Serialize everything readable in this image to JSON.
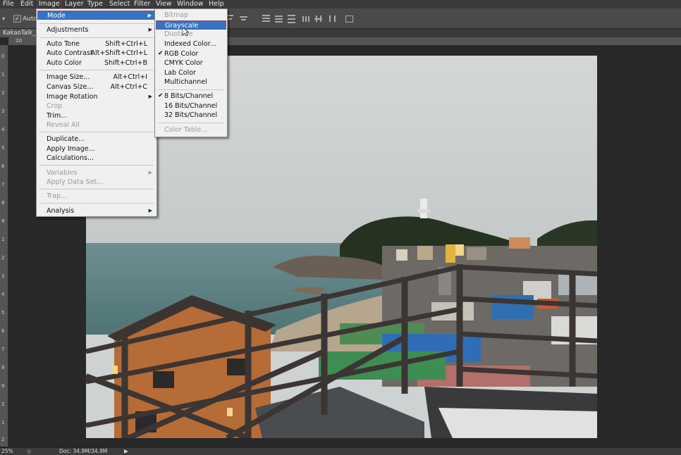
{
  "menubar": {
    "items": [
      "File",
      "Edit",
      "Image",
      "Layer",
      "Type",
      "Select",
      "Filter",
      "View",
      "Window",
      "Help"
    ]
  },
  "options": {
    "auto_label": "Auto"
  },
  "document": {
    "tab_title": "KakaoTalk_2"
  },
  "rulers": {
    "h_labels": [
      "20"
    ],
    "v_labels": [
      "0",
      "1",
      "2",
      "3",
      "4",
      "5",
      "6",
      "7",
      "8",
      "9",
      "1",
      "2",
      "3",
      "4",
      "5",
      "6",
      "7",
      "8",
      "9",
      "2",
      "1",
      "2"
    ]
  },
  "status": {
    "zoom": "25%",
    "doc": "Doc: 34.9M/34.9M"
  },
  "image_menu": {
    "items": [
      {
        "label": "Mode",
        "submenu": true,
        "highlighted": true
      },
      {
        "label": "Adjustments",
        "submenu": true
      },
      {
        "label": "Auto Tone",
        "shortcut": "Shift+Ctrl+L"
      },
      {
        "label": "Auto Contrast",
        "shortcut": "Alt+Shift+Ctrl+L"
      },
      {
        "label": "Auto Color",
        "shortcut": "Shift+Ctrl+B"
      },
      {
        "label": "Image Size...",
        "shortcut": "Alt+Ctrl+I"
      },
      {
        "label": "Canvas Size...",
        "shortcut": "Alt+Ctrl+C"
      },
      {
        "label": "Image Rotation",
        "submenu": true
      },
      {
        "label": "Crop",
        "disabled": true
      },
      {
        "label": "Trim..."
      },
      {
        "label": "Reveal All",
        "disabled": true
      },
      {
        "label": "Duplicate..."
      },
      {
        "label": "Apply Image..."
      },
      {
        "label": "Calculations..."
      },
      {
        "label": "Variables",
        "submenu": true,
        "disabled": true
      },
      {
        "label": "Apply Data Set...",
        "disabled": true
      },
      {
        "label": "Trap...",
        "disabled": true
      },
      {
        "label": "Analysis",
        "submenu": true
      }
    ]
  },
  "mode_menu": {
    "items": [
      {
        "label": "Bitmap",
        "disabled": true
      },
      {
        "label": "Grayscale",
        "highlighted": true
      },
      {
        "label": "Duotone",
        "disabled": true
      },
      {
        "label": "Indexed Color..."
      },
      {
        "label": "RGB Color",
        "checked": true
      },
      {
        "label": "CMYK Color"
      },
      {
        "label": "Lab Color"
      },
      {
        "label": "Multichannel"
      },
      {
        "label": "8 Bits/Channel",
        "checked": true
      },
      {
        "label": "16 Bits/Channel"
      },
      {
        "label": "32 Bits/Channel"
      },
      {
        "label": "Color Table...",
        "disabled": true
      }
    ]
  },
  "colors": {
    "menu_highlight": "#3474c4",
    "focus_dash": "#c9333b",
    "menu_bg": "#f0f0f0",
    "app_bg": "#282828"
  }
}
